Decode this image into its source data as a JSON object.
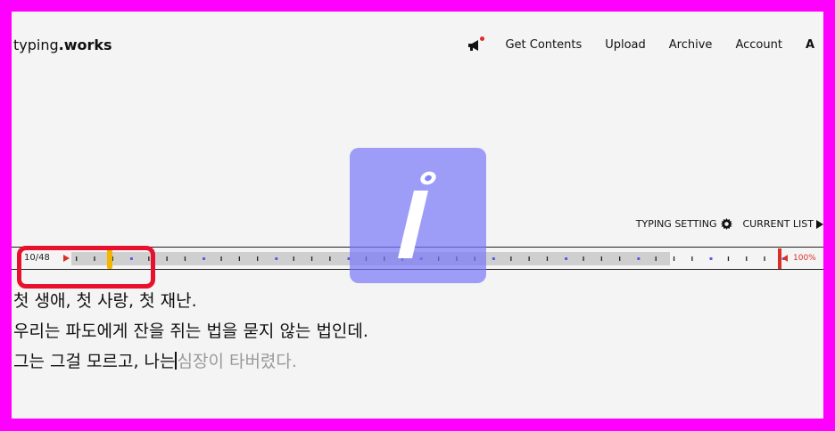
{
  "header": {
    "logo_main": "typing",
    "logo_bold": ".works",
    "nav": [
      "Get Contents",
      "Upload",
      "Archive",
      "Account",
      "A"
    ]
  },
  "settings": {
    "typing_setting": "TYPING SETTING",
    "current_list": "CURRENT LIST"
  },
  "progress": {
    "counter": "10/48",
    "percent_label": "100%",
    "current": 10,
    "total": 48
  },
  "text": {
    "line1": "첫 생애, 첫 사랑, 첫 재난.",
    "line2": "우리는 파도에게 잔을 쥐는 법을 묻지 않는 법인데.",
    "line3_typed": "그는 그걸 모르고, 나는",
    "line3_pending": "심장이 타버렸다."
  },
  "colors": {
    "accent": "#d93025",
    "cursor": "#f2b600",
    "overlay": "#7878fa",
    "highlight_box": "#e8112d",
    "frame": "#ff00ff"
  }
}
